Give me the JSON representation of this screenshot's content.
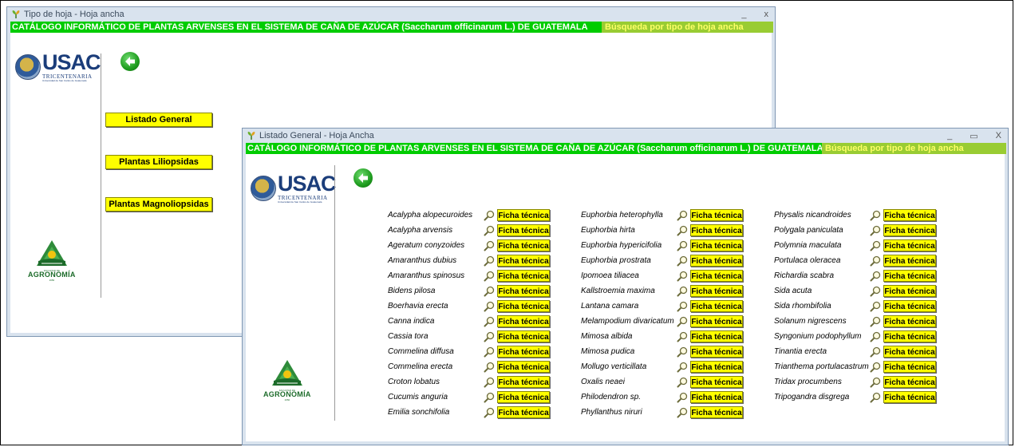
{
  "back_window": {
    "title": "Tipo de hoja - Hoja ancha",
    "banner_title": "CATÁLOGO INFORMÁTICO DE PLANTAS ARVENSES EN EL SISTEMA DE CAÑA DE AZÚCAR (Saccharum officinarum L.) DE GUATEMALA",
    "banner_search": "Búsqueda por tipo de hoja ancha",
    "controls": {
      "minimize": "_",
      "close": "x"
    },
    "menu": [
      "Listado General",
      "Plantas Liliopsidas",
      "Plantas Magnoliopsidas"
    ]
  },
  "front_window": {
    "title": "Listado General - Hoja Ancha",
    "banner_title": "CATÁLOGO INFORMÁTICO DE PLANTAS ARVENSES EN EL SISTEMA DE CAÑA DE AZÚCAR (Saccharum officinarum L.) DE GUATEMALA",
    "banner_search": "Búsqueda por tipo de hoja ancha",
    "controls": {
      "minimize": "_",
      "maximize": "▭",
      "close": "X"
    },
    "ficha_label": "Ficha técnica",
    "columns": [
      [
        "Acalypha alopecuroides",
        "Acalypha arvensis",
        "Ageratum conyzoides",
        "Amaranthus dubius",
        "Amaranthus spinosus",
        "Bidens pilosa",
        "Boerhavia erecta",
        "Canna indica",
        "Cassia tora",
        "Commelina diffusa",
        "Commelina erecta",
        "Croton lobatus",
        "Cucumis anguria",
        "Emilia sonchifolia"
      ],
      [
        "Euphorbia heterophylla",
        "Euphorbia hirta",
        "Euphorbia hypericifolia",
        "Euphorbia prostrata",
        "Ipomoea tiliacea",
        "Kallstroemia maxima",
        "Lantana camara",
        "Melampodium divaricatum",
        "Mimosa albida",
        "Mimosa pudica",
        "Mollugo verticillata",
        "Oxalis neaei",
        "Philodendron sp.",
        "Phyllanthus niruri"
      ],
      [
        "Physalis nicandroides",
        "Polygala paniculata",
        "Polymnia maculata",
        "Portulaca oleracea",
        "Richardia scabra",
        "Sida acuta",
        "Sida rhombifolia",
        "Solanum nigrescens",
        "Syngonium podophyllum",
        "Tinantia erecta",
        "Trianthema portulacastrum",
        "Tridax procumbens",
        "Tripogandra disgrega"
      ]
    ]
  },
  "branding": {
    "usac": "USAC",
    "usac_sub": "TRICENTENARIA",
    "usac_tagline": "Universidad de San Carlos de Guatemala",
    "agronomia": "AGRONOMÍA",
    "agronomia_small": "FACULTAD DE",
    "agronomia_year": "1950"
  },
  "colors": {
    "banner": "#00cc00",
    "search_banner": "#99cc33",
    "button": "#ffff00"
  }
}
